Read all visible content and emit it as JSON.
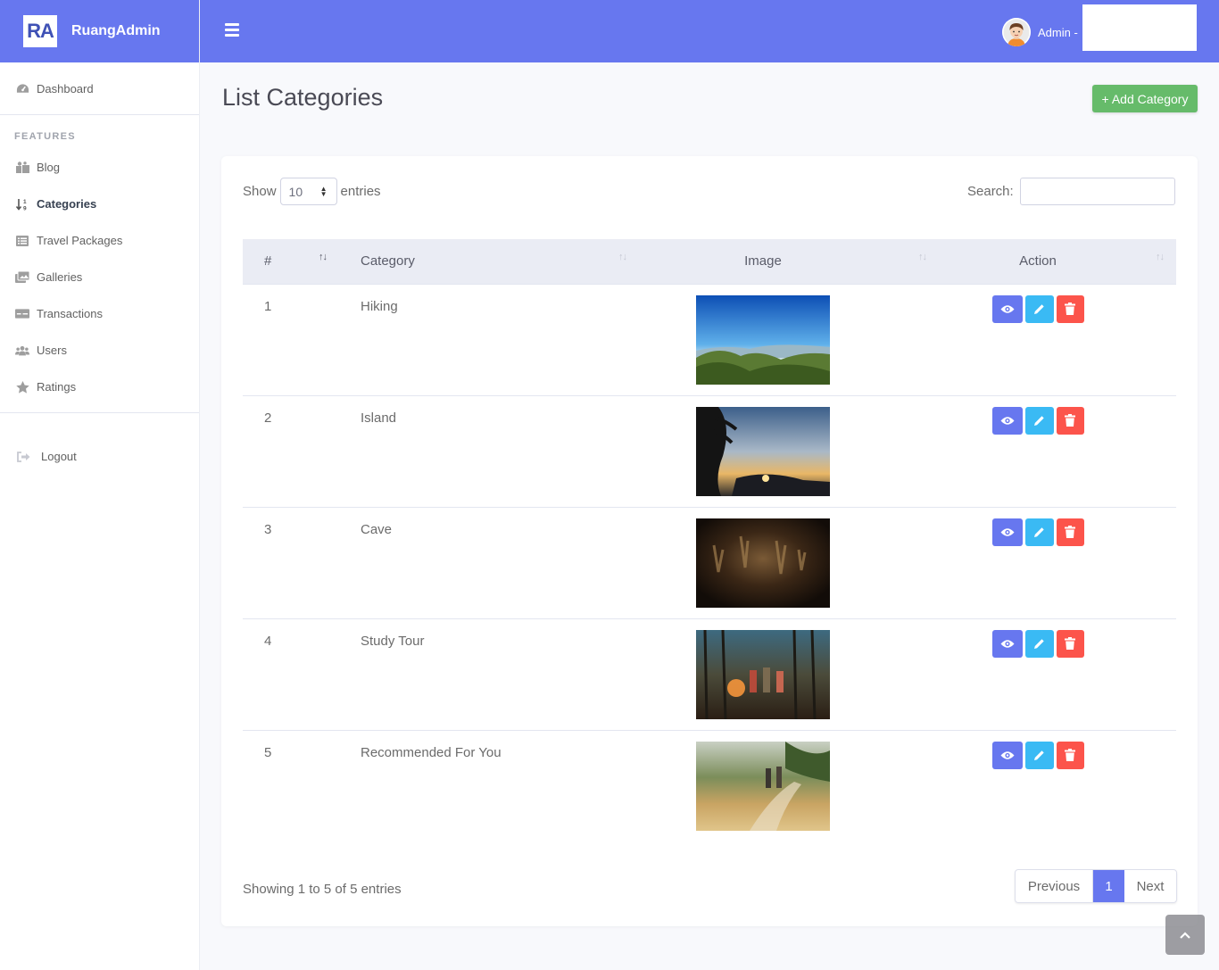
{
  "brand": {
    "logo_text": "RA",
    "name": "RuangAdmin"
  },
  "sidebar": {
    "dashboard": "Dashboard",
    "heading": "FEATURES",
    "items": [
      {
        "label": "Blog",
        "icon": "blog-icon"
      },
      {
        "label": "Categories",
        "icon": "sort-numeric-icon",
        "active": true
      },
      {
        "label": "Travel Packages",
        "icon": "list-icon"
      },
      {
        "label": "Galleries",
        "icon": "images-icon"
      },
      {
        "label": "Transactions",
        "icon": "money-bill-icon"
      },
      {
        "label": "Users",
        "icon": "users-icon"
      },
      {
        "label": "Ratings",
        "icon": "star-icon"
      }
    ],
    "logout": "Logout"
  },
  "topbar": {
    "user_label": "Admin -"
  },
  "page": {
    "title": "List Categories",
    "add_button": "+ Add Category"
  },
  "table_controls": {
    "show_label": "Show",
    "entries_value": "10",
    "entries_label": "entries",
    "search_label": "Search:"
  },
  "table": {
    "columns": [
      "#",
      "Category",
      "Image",
      "Action"
    ],
    "rows": [
      {
        "num": "1",
        "category": "Hiking",
        "image": "mountain-landscape"
      },
      {
        "num": "2",
        "category": "Island",
        "image": "island-sunset"
      },
      {
        "num": "3",
        "category": "Cave",
        "image": "cave-interior"
      },
      {
        "num": "4",
        "category": "Study Tour",
        "image": "campfire-group"
      },
      {
        "num": "5",
        "category": "Recommended For You",
        "image": "hikers-field"
      }
    ]
  },
  "footer": {
    "info": "Showing 1 to 5 of 5 entries",
    "prev": "Previous",
    "page": "1",
    "next": "Next"
  },
  "colors": {
    "primary": "#6777ef",
    "success": "#66bb6a",
    "info": "#3abaf4",
    "danger": "#fc544b"
  }
}
